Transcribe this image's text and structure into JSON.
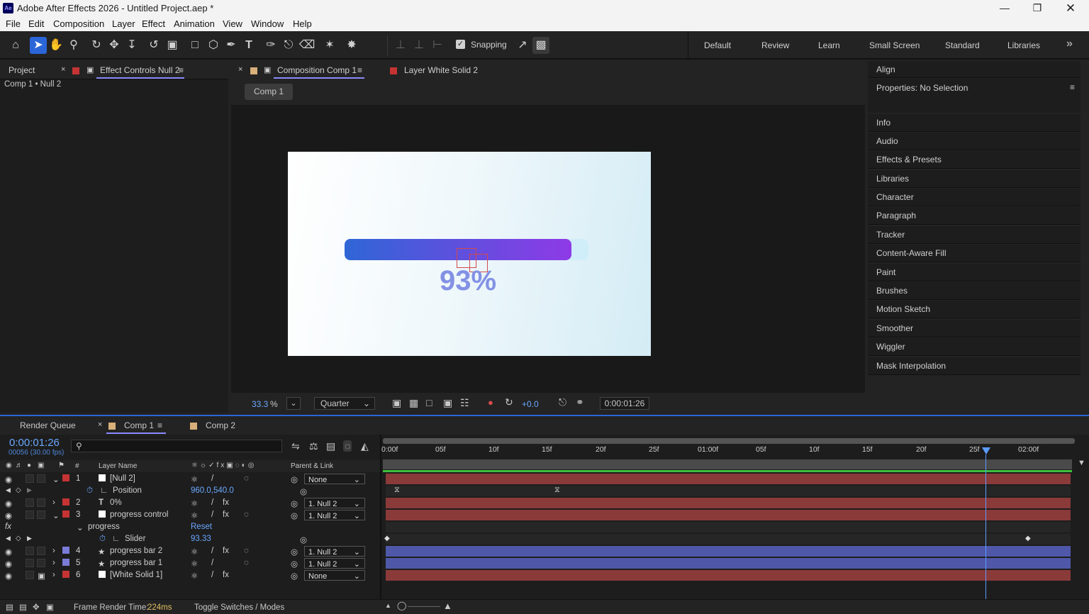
{
  "window": {
    "title": "Adobe After Effects 2026 - Untitled Project.aep *",
    "app_icon": "Ae"
  },
  "menu": [
    "File",
    "Edit",
    "Composition",
    "Layer",
    "Effect",
    "Animation",
    "View",
    "Window",
    "Help"
  ],
  "toolbar": {
    "snapping_label": "Snapping",
    "workspaces": [
      "Default",
      "Review",
      "Learn",
      "Small Screen",
      "Standard",
      "Libraries"
    ]
  },
  "left_panel": {
    "tab_project": "Project",
    "tab_effect_controls": "Effect Controls Null 2",
    "breadcrumb": "Comp 1 • Null 2"
  },
  "comp_panel": {
    "tab_label": "Composition Comp 1",
    "layer_tab_label": "Layer White Solid 2",
    "comp_button": "Comp 1",
    "canvas_text": "93%",
    "progress": 0.93,
    "zoom": "33.3",
    "zoom_unit": "%",
    "resolution": "Quarter",
    "exposure": "+0.0",
    "timecode": "0:00:01:26"
  },
  "right_panel": {
    "align": "Align",
    "properties": "Properties: No Selection",
    "items": [
      "Info",
      "Audio",
      "Effects & Presets",
      "Libraries",
      "Character",
      "Paragraph",
      "Tracker",
      "Content-Aware Fill",
      "Paint",
      "Brushes",
      "Motion Sketch",
      "Smoother",
      "Wiggler",
      "Mask Interpolation"
    ]
  },
  "timeline": {
    "tab_render_queue": "Render Queue",
    "tab_comp1": "Comp 1",
    "tab_comp2": "Comp 2",
    "current_time": "0:00:01:26",
    "frame_info": "00056 (30.00 fps)",
    "col_hash": "#",
    "col_layer_name": "Layer Name",
    "col_parent": "Parent & Link",
    "ruler": [
      "0:00f",
      "05f",
      "10f",
      "15f",
      "20f",
      "25f",
      "01:00f",
      "05f",
      "10f",
      "15f",
      "20f",
      "25f",
      "02:00f"
    ],
    "layers": [
      {
        "num": "1",
        "name": "[Null 2]",
        "parent": "None",
        "color": "#c63333"
      },
      {
        "num": "2",
        "name": "0%",
        "parent": "1. Null 2",
        "color": "#c63333"
      },
      {
        "num": "3",
        "name": "progress control",
        "parent": "1. Null 2",
        "color": "#c63333"
      },
      {
        "num": "4",
        "name": "progress bar 2",
        "parent": "1. Null 2",
        "color": "#7b7bd8"
      },
      {
        "num": "5",
        "name": "progress bar 1",
        "parent": "1. Null 2",
        "color": "#7b7bd8"
      },
      {
        "num": "6",
        "name": "[White Solid 1]",
        "parent": "None",
        "color": "#c63333"
      }
    ],
    "position_label": "Position",
    "position_value": "960.0,540.0",
    "effect_name": "progress",
    "reset_label": "Reset",
    "slider_label": "Slider",
    "slider_value": "93.33",
    "footer_render_label": "Frame Render Time:",
    "footer_render_value": "224ms",
    "footer_toggle": "Toggle Switches / Modes"
  }
}
